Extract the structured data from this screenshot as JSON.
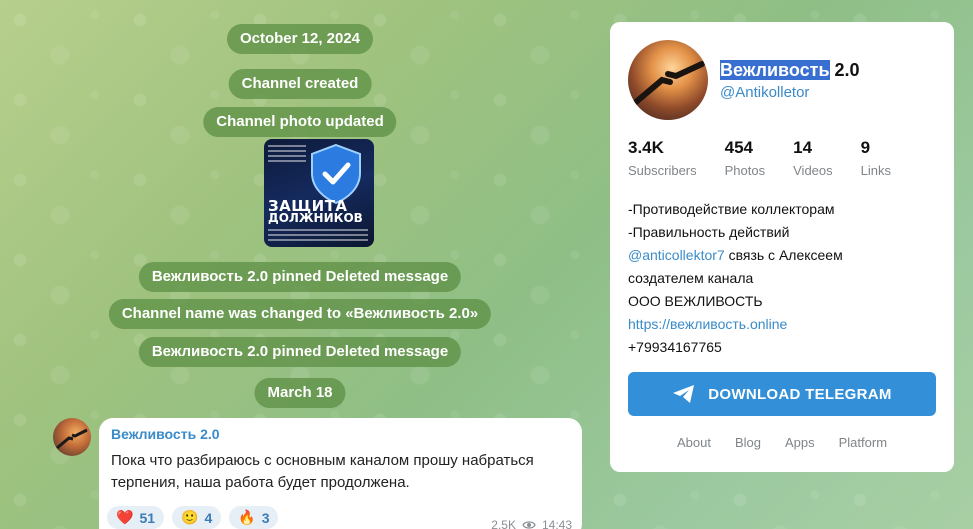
{
  "feed": {
    "date_1": "October 12, 2024",
    "service_1": "Channel created",
    "service_2": "Channel photo updated",
    "photo_title_1": "ЗАЩИТА",
    "photo_title_2": "ДОЛЖНИКОВ",
    "service_3": "Вежливость 2.0 pinned Deleted message",
    "service_4": "Channel name was changed to «Вежливость 2.0»",
    "service_5": "Вежливость 2.0 pinned Deleted message",
    "date_2": "March 18",
    "message": {
      "author": "Вежливость 2.0",
      "line_1": "Пока что разбираюсь с основным каналом прошу набраться",
      "line_2": "терпения, наша работа будет продолжена.",
      "reactions": [
        {
          "emoji": "❤️",
          "count": "51"
        },
        {
          "emoji": "🙂",
          "count": "4"
        },
        {
          "emoji": "🔥",
          "count": "3"
        }
      ],
      "views": "2.5K",
      "time": "14:43"
    }
  },
  "channel": {
    "name_highlight": "Вежливость",
    "name_rest": " 2.0",
    "handle": "@Antikolletor",
    "stats": [
      {
        "num": "3.4K",
        "label": "Subscribers"
      },
      {
        "num": "454",
        "label": "Photos"
      },
      {
        "num": "14",
        "label": "Videos"
      },
      {
        "num": "9",
        "label": "Links"
      }
    ],
    "desc_1": "-Противодействие коллекторам",
    "desc_2": "-Правильность действий",
    "desc_3_link": "@anticollektor7",
    "desc_3_rest": " связь с Алексеем",
    "desc_4": "создателем канала",
    "desc_5": "ООО ВЕЖЛИВОСТЬ",
    "desc_6_link": "https://вежливость.online",
    "desc_7": "+79934167765",
    "download_label": "DOWNLOAD TELEGRAM",
    "footer": [
      "About",
      "Blog",
      "Apps",
      "Platform"
    ]
  },
  "colors": {
    "accent": "#3390d8",
    "link": "#3a8bc9",
    "service_pill": "#5f9146"
  }
}
